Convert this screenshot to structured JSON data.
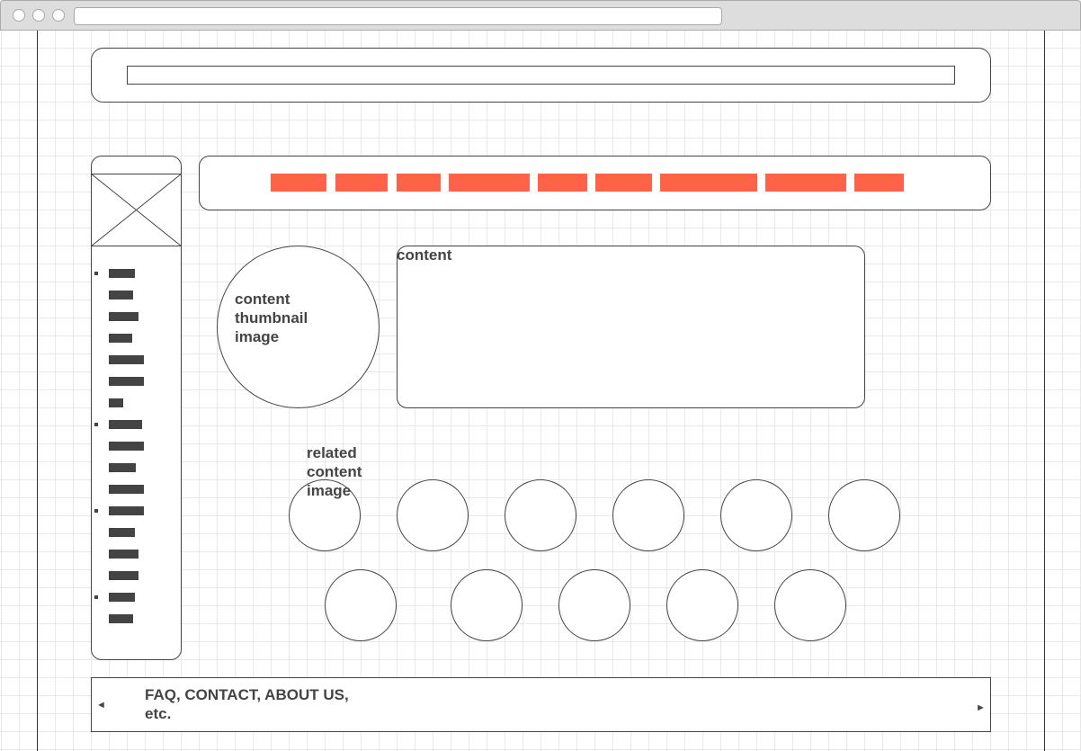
{
  "search": {
    "value": ""
  },
  "content_title": "content",
  "thumbnail_label": "content thumbnail image",
  "related_label": "related content image",
  "footer": {
    "text": "FAQ, CONTACT, ABOUT US, etc.",
    "left_arrow": "◄",
    "right_arrow": "►"
  },
  "nav_count": 9,
  "sidebar_item_count": 17,
  "colors": {
    "accent": "#ff6347",
    "stroke": "#444444"
  }
}
